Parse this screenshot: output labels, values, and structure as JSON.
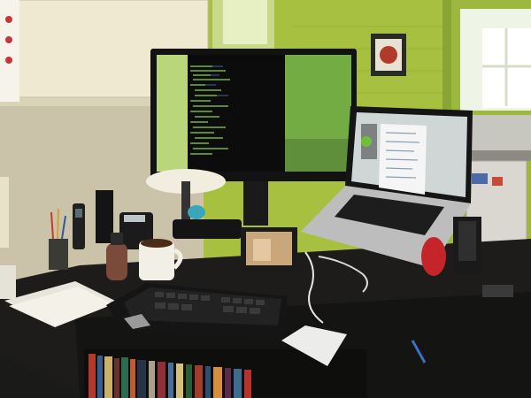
{
  "scene": {
    "description_tags": [
      "home-office",
      "desk",
      "external-monitor",
      "laptop",
      "keyboard",
      "coffee-mug",
      "bookshelf"
    ]
  },
  "colors": {
    "wall_left": "#d8d2b8",
    "wall_right": "#a9c34a",
    "desk": "#1c1b19",
    "monitor_bezel": "#141414",
    "editor_bg": "#0c0c0c",
    "editor_green": "#8fd14a",
    "laptop_silver": "#b9b9b9",
    "mug": "#f2efe6"
  }
}
